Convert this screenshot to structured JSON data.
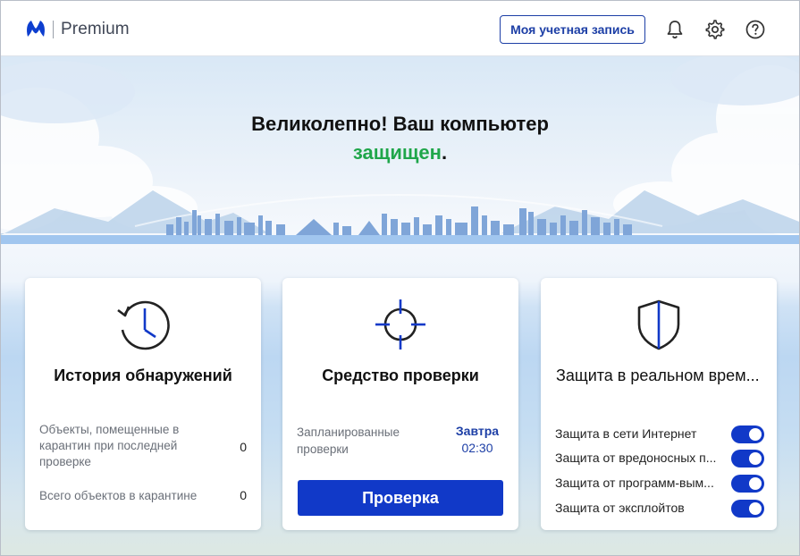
{
  "header": {
    "product_name": "Premium",
    "account_button": "Моя учетная запись",
    "icons": [
      "bell-icon",
      "gear-icon",
      "help-icon"
    ]
  },
  "hero": {
    "headline_line1": "Великолепно! Ваш компьютер",
    "headline_status": "защищен",
    "headline_end": "."
  },
  "cards": {
    "history": {
      "title": "История обнаружений",
      "icon": "clock-history-icon",
      "stats": [
        {
          "label": "Объекты, помещенные в карантин при последней проверке",
          "value": "0"
        },
        {
          "label": "Всего объектов в карантине",
          "value": "0"
        }
      ]
    },
    "scanner": {
      "title": "Средство проверки",
      "icon": "crosshair-icon",
      "scheduled_label": "Запланированные проверки",
      "scheduled_day": "Завтра",
      "scheduled_time": "02:30",
      "scan_button": "Проверка"
    },
    "realtime": {
      "title": "Защита в реальном врем...",
      "icon": "shield-icon",
      "items": [
        {
          "label": "Защита в сети Интернет",
          "enabled": true
        },
        {
          "label": "Защита от вредоносных п...",
          "enabled": true
        },
        {
          "label": "Защита от программ-вым...",
          "enabled": true
        },
        {
          "label": "Защита от эксплойтов",
          "enabled": true
        }
      ]
    }
  },
  "colors": {
    "accent": "#1139c8",
    "brand": "#1d3fa6",
    "status_ok": "#1fa64a"
  }
}
